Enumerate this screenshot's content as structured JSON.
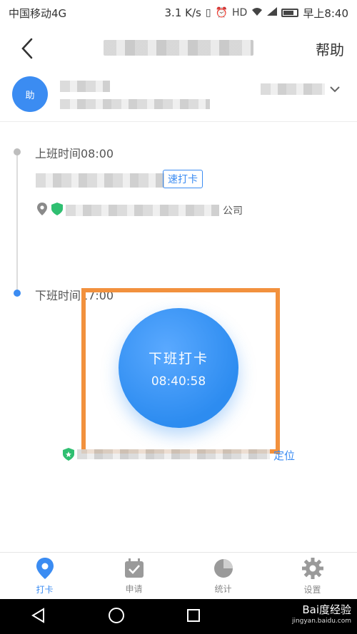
{
  "status_bar": {
    "carrier": "中国移动4G",
    "speed": "3.1 K/s",
    "time": "早上8:40"
  },
  "nav": {
    "help_label": "帮助"
  },
  "user": {
    "avatar_text": "助"
  },
  "timeline": {
    "shift_on_label": "上班时间08:00",
    "record_tag": "速打卡",
    "location_suffix": "公司",
    "shift_off_label": "下班时间17:00"
  },
  "punch": {
    "label": "下班打卡",
    "time": "08:40:58"
  },
  "bottom_note": {
    "suffix": "定位"
  },
  "tabs": [
    {
      "label": "打卡",
      "icon": "location-pin-icon",
      "active": true
    },
    {
      "label": "申请",
      "icon": "checkbox-icon",
      "active": false
    },
    {
      "label": "统计",
      "icon": "pie-chart-icon",
      "active": false
    },
    {
      "label": "设置",
      "icon": "gear-icon",
      "active": false
    }
  ],
  "watermark": {
    "brand": "Bai度经验",
    "url": "jingyan.baidu.com"
  },
  "colors": {
    "accent": "#3b8cf2",
    "highlight": "#f2913d"
  }
}
